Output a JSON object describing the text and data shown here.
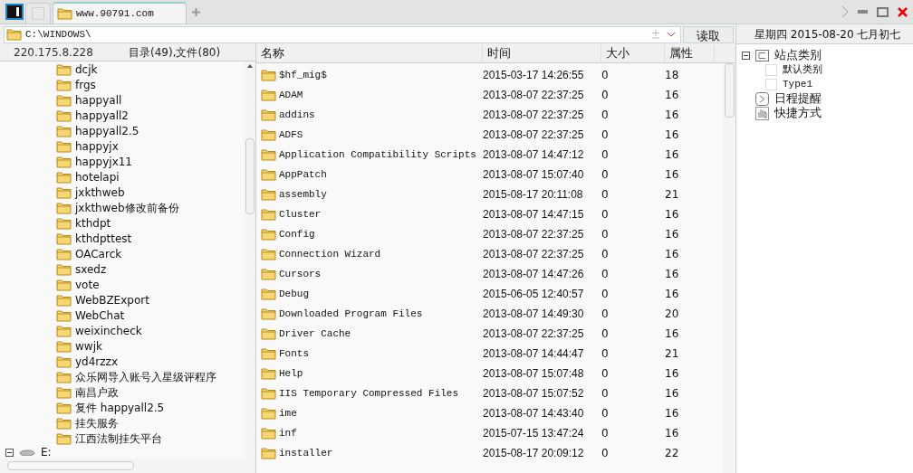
{
  "tabs": [
    {
      "label": "www.90791.com",
      "selected": true
    }
  ],
  "address": {
    "value": "C:\\WINDOWS\\",
    "button": "读取"
  },
  "date": "星期四 2015-08-20 七月初七",
  "left_panel": {
    "ip": "220.175.8.228",
    "summary": "目录(49),文件(80)",
    "items": [
      {
        "kind": "folder",
        "label": "dcjk"
      },
      {
        "kind": "folder",
        "label": "frgs"
      },
      {
        "kind": "folder",
        "label": "happyall"
      },
      {
        "kind": "folder",
        "label": "happyall2"
      },
      {
        "kind": "folder",
        "label": "happyall2.5"
      },
      {
        "kind": "folder",
        "label": "happyjx"
      },
      {
        "kind": "folder",
        "label": "happyjx11"
      },
      {
        "kind": "folder",
        "label": "hotelapi"
      },
      {
        "kind": "folder",
        "label": "jxkthweb"
      },
      {
        "kind": "folder",
        "label": "jxkthweb修改前备份"
      },
      {
        "kind": "folder",
        "label": "kthdpt"
      },
      {
        "kind": "folder",
        "label": "kthdpttest"
      },
      {
        "kind": "folder",
        "label": "OACarck"
      },
      {
        "kind": "folder",
        "label": "sxedz"
      },
      {
        "kind": "folder",
        "label": "vote"
      },
      {
        "kind": "folder",
        "label": "WebBZExport"
      },
      {
        "kind": "folder",
        "label": "WebChat"
      },
      {
        "kind": "folder",
        "label": "weixincheck"
      },
      {
        "kind": "folder",
        "label": "wwjk"
      },
      {
        "kind": "folder",
        "label": "yd4rzzx"
      },
      {
        "kind": "folder",
        "label": "众乐网导入账号入星级评程序"
      },
      {
        "kind": "folder",
        "label": "南昌户政"
      },
      {
        "kind": "folder",
        "label": "复件 happyall2.5"
      },
      {
        "kind": "folder",
        "label": "挂失服务"
      },
      {
        "kind": "folder",
        "label": "江西法制挂失平台"
      },
      {
        "kind": "drive",
        "label": "E:",
        "expanded": true
      }
    ]
  },
  "table": {
    "columns": [
      "名称",
      "时间",
      "大小",
      "属性"
    ],
    "rows": [
      [
        "$hf_mig$",
        "2015-03-17 14:26:55",
        "0",
        "18"
      ],
      [
        "ADAM",
        "2013-08-07 22:37:25",
        "0",
        "16"
      ],
      [
        "addins",
        "2013-08-07 22:37:25",
        "0",
        "16"
      ],
      [
        "ADFS",
        "2013-08-07 22:37:25",
        "0",
        "16"
      ],
      [
        "Application Compatibility Scripts",
        "2013-08-07 14:47:12",
        "0",
        "16"
      ],
      [
        "AppPatch",
        "2013-08-07 15:07:40",
        "0",
        "16"
      ],
      [
        "assembly",
        "2015-08-17 20:11:08",
        "0",
        "21"
      ],
      [
        "Cluster",
        "2013-08-07 14:47:15",
        "0",
        "16"
      ],
      [
        "Config",
        "2013-08-07 22:37:25",
        "0",
        "16"
      ],
      [
        "Connection Wizard",
        "2013-08-07 22:37:25",
        "0",
        "16"
      ],
      [
        "Cursors",
        "2013-08-07 14:47:26",
        "0",
        "16"
      ],
      [
        "Debug",
        "2015-06-05 12:40:57",
        "0",
        "16"
      ],
      [
        "Downloaded Program Files",
        "2013-08-07 14:49:30",
        "0",
        "20"
      ],
      [
        "Driver Cache",
        "2013-08-07 22:37:25",
        "0",
        "16"
      ],
      [
        "Fonts",
        "2013-08-07 14:44:47",
        "0",
        "21"
      ],
      [
        "Help",
        "2013-08-07 15:07:48",
        "0",
        "16"
      ],
      [
        "IIS Temporary Compressed Files",
        "2013-08-07 15:07:52",
        "0",
        "16"
      ],
      [
        "ime",
        "2013-08-07 14:43:40",
        "0",
        "16"
      ],
      [
        "inf",
        "2015-07-15 13:47:24",
        "0",
        "16"
      ],
      [
        "installer",
        "2015-08-17 20:09:12",
        "0",
        "22"
      ]
    ]
  },
  "right_tree": [
    {
      "kind": "category",
      "label": "站点类别",
      "expanded": true,
      "children": [
        {
          "kind": "item",
          "label": "默认类别"
        },
        {
          "kind": "item",
          "label": "Type1"
        }
      ]
    },
    {
      "kind": "schedule",
      "label": "日程提醒"
    },
    {
      "kind": "shortcut",
      "label": "快捷方式"
    }
  ]
}
